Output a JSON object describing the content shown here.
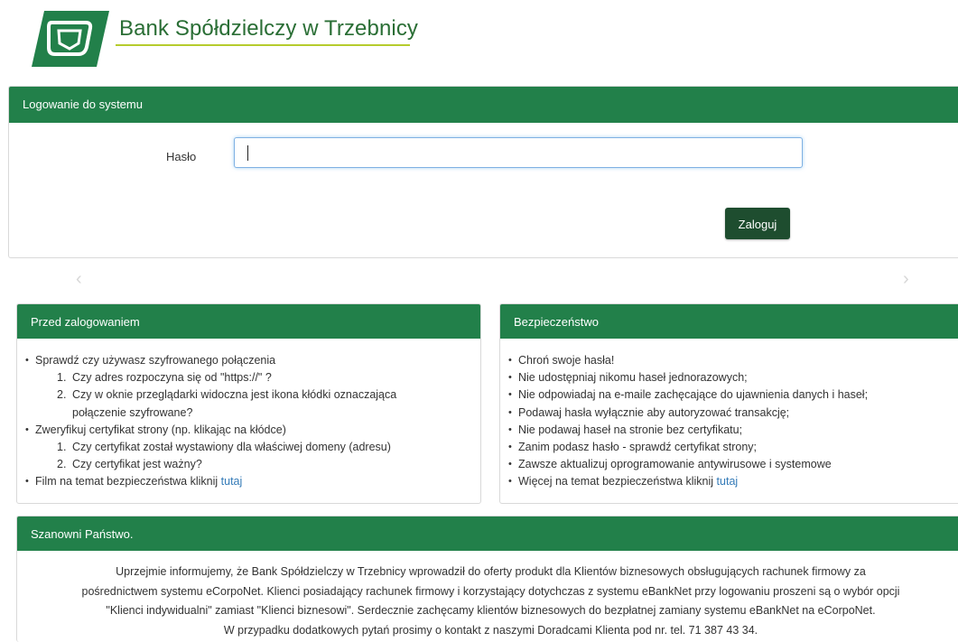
{
  "header": {
    "bank_name": "Bank Spółdzielczy w Trzebnicy",
    "logo_icon": "bank-shield-logo-icon",
    "brand_color": "#22804a",
    "accent_color": "#b6cc2d"
  },
  "login": {
    "title": "Logowanie do systemu",
    "password_label": "Hasło",
    "password_value": "",
    "submit_label": "Zaloguj"
  },
  "nav": {
    "prev_glyph": "‹",
    "next_glyph": "›"
  },
  "before_login": {
    "title": "Przed zalogowaniem",
    "item1": "Sprawdź czy używasz szyfrowanego połączenia",
    "item1_sub1_num": "1.",
    "item1_sub1": "Czy adres rozpoczyna się od \"https://\" ?",
    "item1_sub2_num": "2.",
    "item1_sub2_line1": "Czy w oknie przeglądarki widoczna jest ikona kłódki oznaczająca",
    "item1_sub2_line2": "połączenie szyfrowane?",
    "item2": "Zweryfikuj certyfikat strony (np. klikając na kłódce)",
    "item2_sub1_num": "1.",
    "item2_sub1": "Czy certyfikat został wystawiony dla właściwej domeny (adresu)",
    "item2_sub2_num": "2.",
    "item2_sub2": "Czy certyfikat jest ważny?",
    "item3_text": "Film na temat bezpieczeństwa kliknij ",
    "item3_link": "tutaj"
  },
  "security": {
    "title": "Bezpieczeństwo",
    "items": [
      "Chroń swoje hasła!",
      "Nie udostępniaj nikomu haseł jednorazowych;",
      "Nie odpowiadaj na e-maile zachęcające do ujawnienia danych i haseł;",
      "Podawaj hasła wyłącznie aby autoryzować transakcję;",
      "Nie podawaj haseł na stronie bez certyfikatu;",
      "Zanim podasz hasło - sprawdź certyfikat strony;",
      "Zawsze aktualizuj oprogramowanie antywirusowe i systemowe"
    ],
    "last_text": "Więcej na temat bezpieczeństwa kliknij ",
    "last_link": "tutaj"
  },
  "notice": {
    "title": "Szanowni Państwo.",
    "lines": [
      "Uprzejmie informujemy, że Bank Spółdzielczy w Trzebnicy wprowadził do oferty produkt dla Klientów biznesowych obsługujących rachunek firmowy za",
      "pośrednictwem systemu eCorpoNet. Klienci posiadający rachunek firmowy i korzystający dotychczas z systemu eBankNet przy logowaniu proszeni są o wybór opcji",
      "\"Klienci indywidualni\" zamiast \"Klienci biznesowi\". Serdecznie zachęcamy klientów biznesowych do bezpłatnej zamiany systemu eBankNet na eCorpoNet.",
      "W przypadku dodatkowych pytań prosimy o kontakt z naszymi Doradcami Klienta pod nr. tel. 71 387 43 34."
    ]
  }
}
